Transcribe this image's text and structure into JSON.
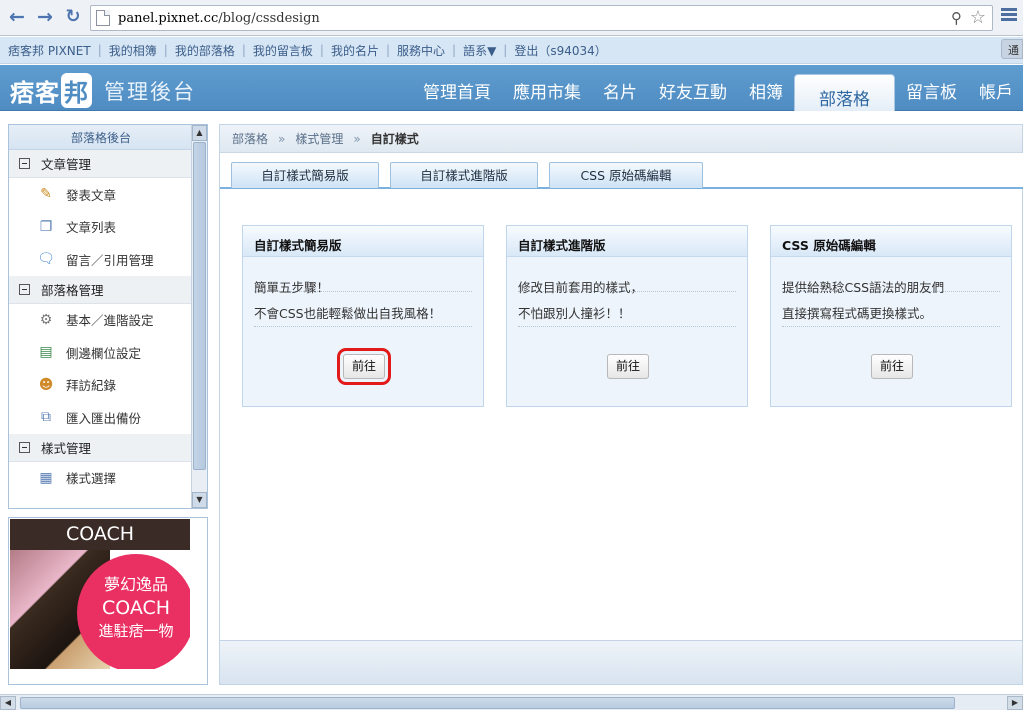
{
  "browser": {
    "url_host": "panel.pixnet.cc",
    "url_path": "/blog/cssdesign"
  },
  "toplinks": {
    "items": [
      "痞客邦 PIXNET",
      "我的相簿",
      "我的部落格",
      "我的留言板",
      "我的名片",
      "服務中心",
      "語系▼",
      "登出（s94034）"
    ],
    "corner": "通"
  },
  "header": {
    "logo_main": "痞客",
    "logo_badge": "邦",
    "admin_title": "管理後台",
    "nav": [
      "管理首頁",
      "應用市集",
      "名片",
      "好友互動",
      "相簿",
      "部落格",
      "留言板",
      "帳戶"
    ]
  },
  "sidebar": {
    "title": "部落格後台",
    "sections": [
      {
        "label": "文章管理",
        "items": [
          {
            "label": "發表文章",
            "icon": "pencil-icon"
          },
          {
            "label": "文章列表",
            "icon": "documents-icon"
          },
          {
            "label": "留言／引用管理",
            "icon": "speech-bubble-icon"
          }
        ]
      },
      {
        "label": "部落格管理",
        "items": [
          {
            "label": "基本／進階設定",
            "icon": "gear-icon"
          },
          {
            "label": "側邊欄位設定",
            "icon": "layout-icon"
          },
          {
            "label": "拜訪紀錄",
            "icon": "users-icon"
          },
          {
            "label": "匯入匯出備份",
            "icon": "copy-icon"
          }
        ]
      },
      {
        "label": "樣式管理",
        "items": [
          {
            "label": "樣式選擇",
            "icon": "grid-icon"
          }
        ]
      }
    ]
  },
  "ad": {
    "band": "COACH",
    "line1": "夢幻逸品",
    "line2": "COACH",
    "line3": "進駐痞一物"
  },
  "main": {
    "breadcrumb": [
      "部落格",
      "樣式管理",
      "自訂樣式"
    ],
    "breadcrumb_sep": "»",
    "tabs": [
      "自訂樣式簡易版",
      "自訂樣式進階版",
      "CSS 原始碼編輯"
    ],
    "cards": [
      {
        "title": "自訂樣式簡易版",
        "line1": "簡單五步驟！",
        "line2": "不會CSS也能輕鬆做出自我風格！",
        "button": "前往",
        "highlighted": true
      },
      {
        "title": "自訂樣式進階版",
        "line1": "修改目前套用的樣式，",
        "line2": "不怕跟別人撞衫！！",
        "button": "前往",
        "highlighted": false
      },
      {
        "title": "CSS 原始碼編輯",
        "line1": "提供給熟稔CSS語法的朋友們",
        "line2": "直接撰寫程式碼更換樣式。",
        "button": "前往",
        "highlighted": false
      }
    ]
  },
  "colors": {
    "header_blue": "#4f8cc2",
    "highlight_red": "#e21a1a",
    "ad_pink": "#ea2f62"
  }
}
